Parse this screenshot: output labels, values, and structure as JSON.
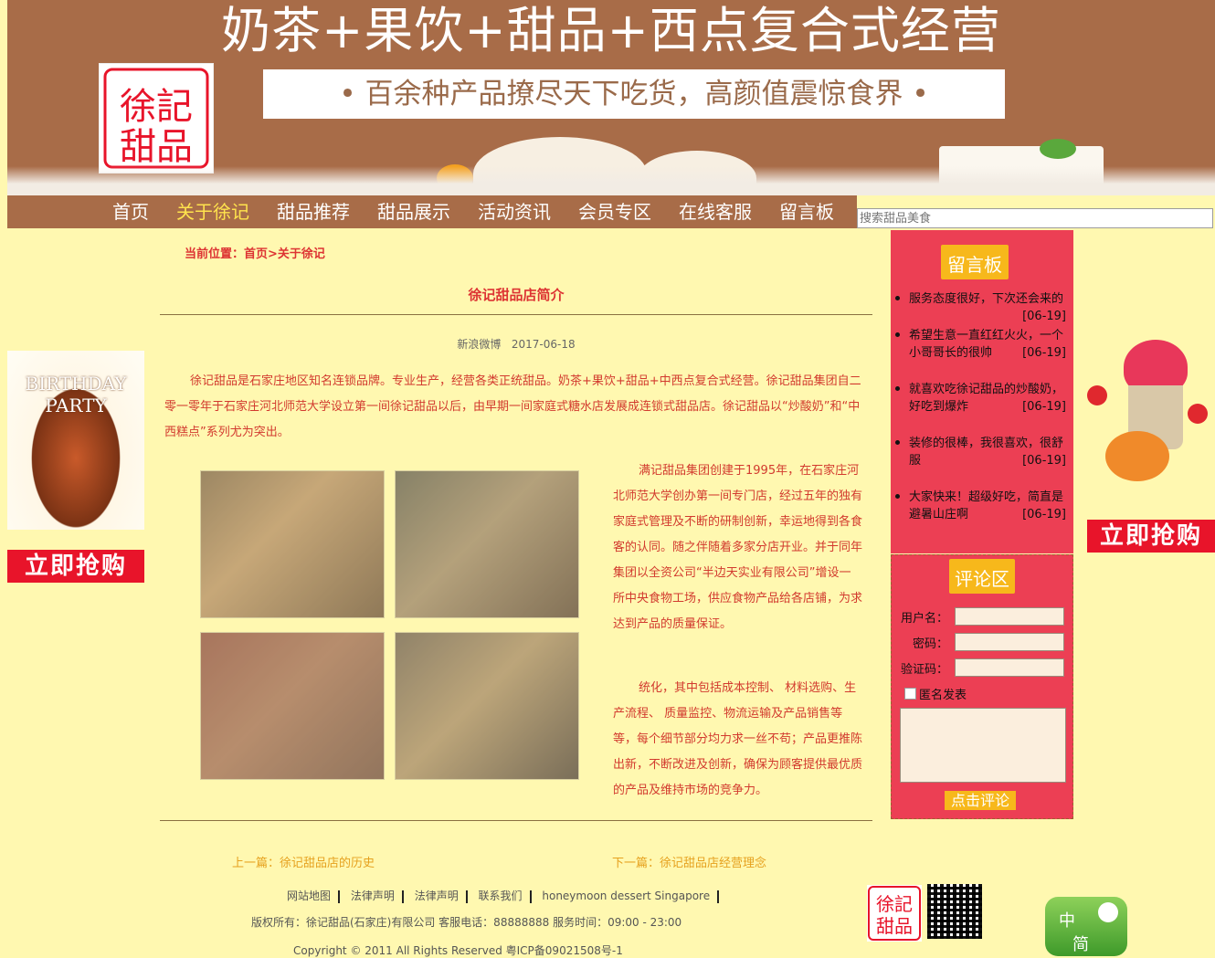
{
  "banner": {
    "title": "奶茶+果饮+甜品+西点复合式经营",
    "subtitle": "• 百余种产品撩尽天下吃货，高颜值震惊食界 •",
    "logo_text": "徐記甜品"
  },
  "nav": {
    "items": [
      "首页",
      "关于徐记",
      "甜品推荐",
      "甜品展示",
      "活动资讯",
      "会员专区",
      "在线客服",
      "留言板"
    ],
    "active_index": 1,
    "search_placeholder": "搜索甜品美食"
  },
  "breadcrumb": "当前位置：首页>关于徐记",
  "article": {
    "title": "徐记甜品店简介",
    "source": "新浪微博",
    "date": "2017-06-18",
    "para1": "徐记甜品是石家庄地区知名连锁品牌。专业生产，经营各类正统甜品。奶茶+果饮+甜品+中西点复合式经营。徐记甜品集团自二零一零年于石家庄河北师范大学设立第一间徐记甜品以后，由早期一间家庭式糖水店发展成连锁式甜品店。徐记甜品以“炒酸奶”和“中西糕点”系列尤为突出。",
    "para2": "满记甜品集团创建于1995年，在石家庄河北师范大学创办第一间专门店，经过五年的独有家庭式管理及不断的研制创新，幸运地得到各食客的认同。随之伴随着多家分店开业。并于同年集团以全资公司“半边天实业有限公司”增设一所中央食物工场，供应食物产品给各店铺，为求达到产品的质量保证。",
    "para3": "统化，其中包括成本控制、 材料选购、生产流程、 质量监控、物流运输及产品销售等等，每个细节部分均力求一丝不苟；产品更推陈出新，不断改进及创新，确保为顾客提供最优质的产品及维持市场的竞争力。",
    "prev": "上一篇：徐记甜品店的历史",
    "next": "下一篇：徐记甜品店经营理念"
  },
  "sidebar": {
    "message_board_title": "留言板",
    "messages": [
      {
        "text": "服务态度很好，下次还会来的",
        "date": "[06-19]"
      },
      {
        "text": "希望生意一直红红火火，一个小哥哥长的很帅",
        "date": "[06-19]"
      },
      {
        "text": "就喜欢吃徐记甜品的炒酸奶，好吃到爆炸",
        "date": "[06-19]"
      },
      {
        "text": "装修的很棒，我很喜欢，很舒服",
        "date": "[06-19]"
      },
      {
        "text": "大家快来！超级好吃，简直是避暑山庄啊",
        "date": "[06-19]"
      }
    ],
    "comment_title": "评论区",
    "username_label": "用户名：",
    "password_label": "密码：",
    "captcha_label": "验证码：",
    "anonymous_label": "匿名发表",
    "submit_label": "点击评论"
  },
  "ads": {
    "left_img_text": "BIRTHDAY PARTY",
    "left_buy": "立即抢购",
    "right_buy": "立即抢购"
  },
  "footer": {
    "links": [
      "网站地图",
      "法律声明",
      "法律声明",
      "联系我们",
      "honeymoon dessert Singapore"
    ],
    "copyright1": "版权所有：徐记甜品(石家庄)有限公司 客服电话：88888888 服务时间：09:00 - 23:00",
    "copyright2": "Copyright © 2011 All Rights Reserved 粤ICP备09021508号-1",
    "lang_labels": [
      "中",
      "简"
    ]
  },
  "colors": {
    "page_bg": "#fff8b0",
    "banner_brown": "#a86c48",
    "accent_red": "#ec3f54",
    "accent_yellow": "#f7b81b",
    "text_red": "#d23a2e"
  }
}
